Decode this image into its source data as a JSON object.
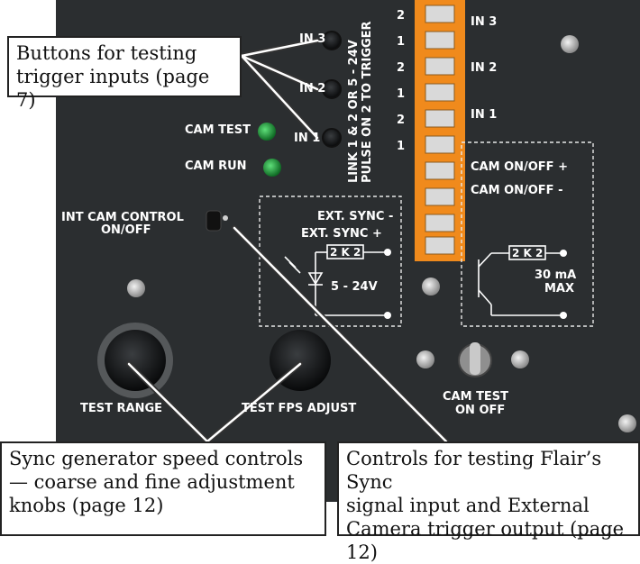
{
  "panel_labels": {
    "in3": "IN 3",
    "in2": "IN 2",
    "in1": "IN 1",
    "cam_test": "CAM TEST",
    "cam_run": "CAM RUN",
    "link_line1": "LINK 1 & 2 OR 5 - 24V",
    "link_line2": "PULSE ON 2 TO TRIGGER",
    "terminal_numbers": [
      "2",
      "1",
      "2",
      "1",
      "2",
      "1"
    ],
    "strip_in3": "IN 3",
    "strip_in2": "IN 2",
    "strip_in1": "IN 1",
    "cam_onoff_plus": "CAM ON/OFF +",
    "cam_onoff_minus": "CAM ON/OFF -",
    "int_cam_control_1": "INT CAM CONTROL",
    "int_cam_control_2": "ON/OFF",
    "ext_sync_minus": "EXT. SYNC -",
    "ext_sync_plus": "EXT. SYNC +",
    "resistor_left": "2 K 2",
    "voltage": "5 - 24V",
    "resistor_right": "2 K 2",
    "current_1": "30 mA",
    "current_2": "MAX",
    "test_range": "TEST RANGE",
    "test_fps_adjust": "TEST FPS ADJUST",
    "cam_test_switch_1": "CAM TEST",
    "cam_test_switch_2": "ON OFF"
  },
  "callouts": {
    "trigger_buttons": [
      "Buttons for testing",
      "trigger inputs (page 7)"
    ],
    "sync_speed": [
      "Sync generator speed controls",
      "— coarse and fine adjustment",
      "knobs (page 12)"
    ],
    "sync_signal": [
      "Controls for testing Flair’s Sync",
      "signal input and External",
      "Camera trigger output (page 12)"
    ]
  },
  "colors": {
    "panel": "#2b2e30",
    "terminal": "#f08a1c",
    "led": "#1f9a3a"
  }
}
